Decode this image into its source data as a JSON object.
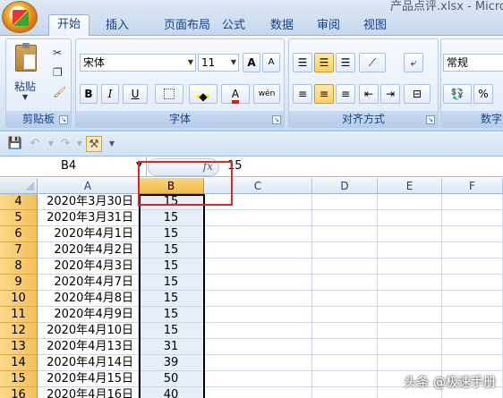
{
  "window": {
    "title": "产品点评.xlsx - Micro"
  },
  "tabs": [
    {
      "label": "开始",
      "active": true
    },
    {
      "label": "插入"
    },
    {
      "label": "页面布局"
    },
    {
      "label": "公式"
    },
    {
      "label": "数据"
    },
    {
      "label": "审阅"
    },
    {
      "label": "视图"
    }
  ],
  "ribbon": {
    "clipboard": {
      "label": "剪贴板",
      "paste_label": "粘贴"
    },
    "font": {
      "label": "字体",
      "font_name": "宋体",
      "font_size": "11",
      "bold": "B",
      "italic": "I",
      "underline": "U",
      "grow": "A",
      "shrink": "A",
      "color_letter": "A",
      "phonetic": "wén"
    },
    "alignment": {
      "label": "对齐方式"
    },
    "number": {
      "label": "数字",
      "format": "常规",
      "percent": "%"
    }
  },
  "formula_bar": {
    "name_box": "B4",
    "fx": "fx",
    "value": "15"
  },
  "columns": [
    "A",
    "B",
    "C",
    "D",
    "E",
    "F"
  ],
  "selected_column": "B",
  "rows": [
    {
      "row": "4",
      "a": "2020年3月30日",
      "b": "15"
    },
    {
      "row": "5",
      "a": "2020年3月31日",
      "b": "15"
    },
    {
      "row": "6",
      "a": "2020年4月1日",
      "b": "15"
    },
    {
      "row": "7",
      "a": "2020年4月2日",
      "b": "15"
    },
    {
      "row": "8",
      "a": "2020年4月3日",
      "b": "15"
    },
    {
      "row": "9",
      "a": "2020年4月7日",
      "b": "15"
    },
    {
      "row": "10",
      "a": "2020年4月8日",
      "b": "15"
    },
    {
      "row": "11",
      "a": "2020年4月9日",
      "b": "15"
    },
    {
      "row": "12",
      "a": "2020年4月10日",
      "b": "15"
    },
    {
      "row": "13",
      "a": "2020年4月13日",
      "b": "31"
    },
    {
      "row": "14",
      "a": "2020年4月14日",
      "b": "39"
    },
    {
      "row": "15",
      "a": "2020年4月15日",
      "b": "50"
    },
    {
      "row": "16",
      "a": "2020年4月16日",
      "b": "40"
    }
  ],
  "watermark": "头条 @极速手册"
}
